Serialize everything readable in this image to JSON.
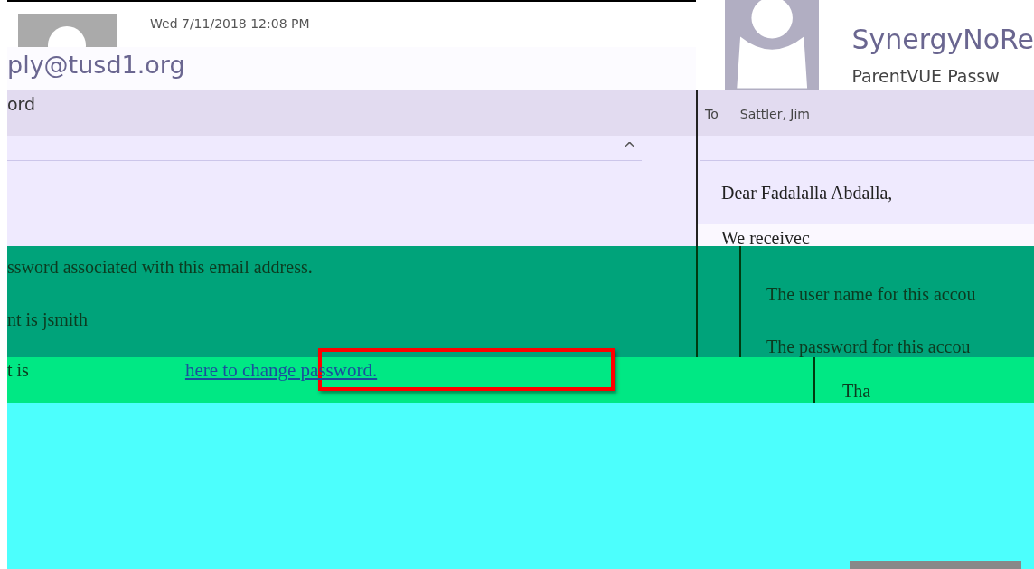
{
  "left_message": {
    "date": "Wed 7/11/2018 12:08 PM",
    "sender": "ply@tusd1.org",
    "subject": "ord",
    "collapse_icon": "^",
    "body": [
      "ssword associated with this email address.",
      "nt is jsmith"
    ],
    "password_line": "t is",
    "link": "here to change password."
  },
  "right_message": {
    "sender": "SynergyNoRe",
    "subject": "ParentVUE Passw",
    "to_label": "To",
    "to": "Sattler, Jim",
    "greeting": "Dear Fadalalla Abdalla,",
    "intro": "We receivec",
    "body": [
      "The user name for this accou",
      "The password for this accou"
    ],
    "closing": "Tha"
  }
}
